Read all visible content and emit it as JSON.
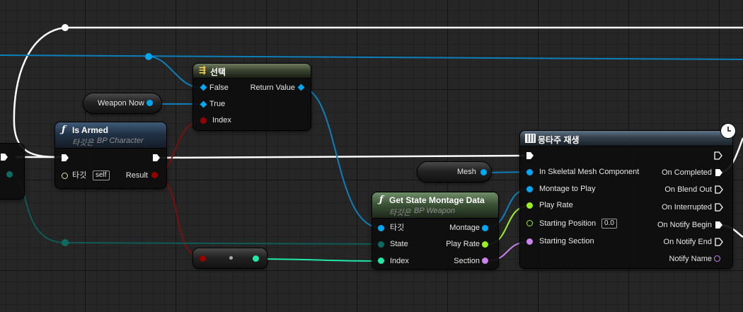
{
  "graph": {
    "colors": {
      "exec": "#ffffff",
      "object": "#00a8f4",
      "bool": "#950000",
      "float": "#9dee20",
      "name": "#c884ea",
      "byte": "#006f65",
      "int": "#20e8a8"
    }
  },
  "select_node": {
    "icon": "select-icon",
    "title": "선택",
    "pins": {
      "false": "False",
      "true": "True",
      "index": "Index",
      "return_value": "Return Value"
    }
  },
  "weapon_now": {
    "label": "Weapon Now"
  },
  "mesh": {
    "label": "Mesh"
  },
  "is_armed": {
    "icon": "function-icon",
    "title": "Is Armed",
    "target_prefix": "타깃은",
    "target_class": "BP Character",
    "pins": {
      "target": "타깃",
      "self_value": "self",
      "result": "Result"
    }
  },
  "get_state": {
    "icon": "function-icon",
    "title": "Get State Montage Data",
    "target_prefix": "타깃은",
    "target_class": "BP Weapon",
    "pins": {
      "target": "타깃",
      "state": "State",
      "index": "Index",
      "montage": "Montage",
      "play_rate": "Play Rate",
      "section": "Section"
    }
  },
  "montage": {
    "icon": "montage-icon",
    "title": "몽타주 재생",
    "latent_icon": "clock-icon",
    "pins": {
      "skeletal": "In Skeletal Mesh Component",
      "montage_to_play": "Montage to Play",
      "play_rate": "Play Rate",
      "starting_position": "Starting Position",
      "starting_position_value": "0.0",
      "starting_section": "Starting Section",
      "on_completed": "On Completed",
      "on_blend_out": "On Blend Out",
      "on_interrupted": "On Interrupted",
      "on_notify_begin": "On Notify Begin",
      "on_notify_end": "On Notify End",
      "notify_name": "Notify Name"
    }
  }
}
